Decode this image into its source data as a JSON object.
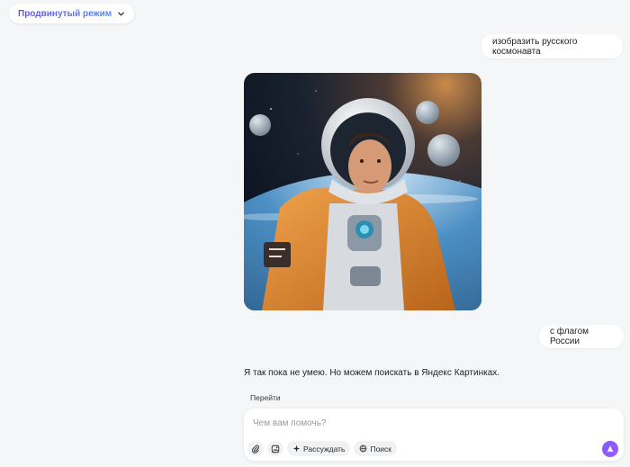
{
  "header": {
    "mode_label": "Продвинутый режим"
  },
  "messages": [
    {
      "role": "user",
      "text": "изобразить русского космонавта"
    },
    {
      "role": "assistant",
      "image": "astronaut-image"
    },
    {
      "role": "user",
      "text": "с флагом России"
    },
    {
      "role": "assistant",
      "text": "Я так пока не умею. Но можем поискать в Яндекс Картинках."
    }
  ],
  "actions": {
    "goto_label": "Перейти"
  },
  "composer": {
    "placeholder": "Чем вам помочь?",
    "value": "",
    "tools": [
      {
        "icon": "paperclip-icon",
        "label": ""
      },
      {
        "icon": "image-add-icon",
        "label": ""
      },
      {
        "icon": "sparkle-icon",
        "label": "Рассуждать"
      },
      {
        "icon": "globe-icon",
        "label": "Поиск"
      }
    ],
    "send_icon": "alice-send-icon"
  },
  "colors": {
    "accent": "#7a5cff",
    "background": "#f5f6f8",
    "bubble": "#ffffff"
  }
}
